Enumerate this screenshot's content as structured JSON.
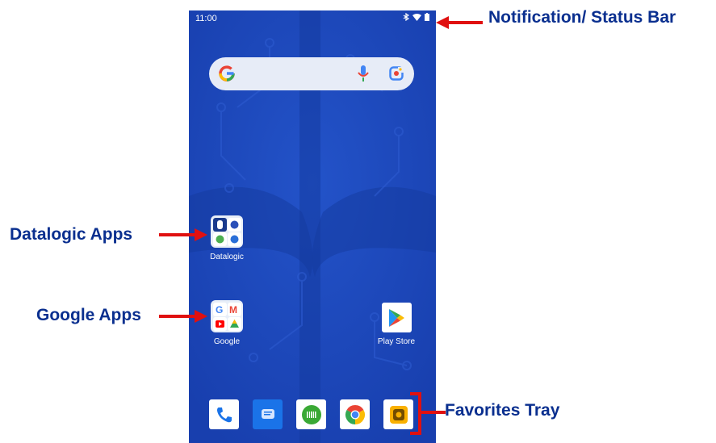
{
  "status_bar": {
    "time": "11:00"
  },
  "search_bar": {
    "google_logo": "G"
  },
  "apps": {
    "datalogic_folder": {
      "label": "Datalogic"
    },
    "google_folder": {
      "label": "Google"
    },
    "play_store": {
      "label": "Play Store"
    }
  },
  "dock": {
    "items": [
      "phone-icon",
      "messages-icon",
      "scanner-icon",
      "chrome-icon",
      "camera-icon"
    ]
  },
  "annotations": {
    "status_bar": "Notification/ Status Bar",
    "datalogic_apps": "Datalogic Apps",
    "google_apps": "Google Apps",
    "favorites_tray": "Favorites Tray"
  },
  "colors": {
    "wallpaper": "#1a44b8",
    "annotation_text": "#0a2f8f",
    "annotation_arrow": "#e01010"
  }
}
